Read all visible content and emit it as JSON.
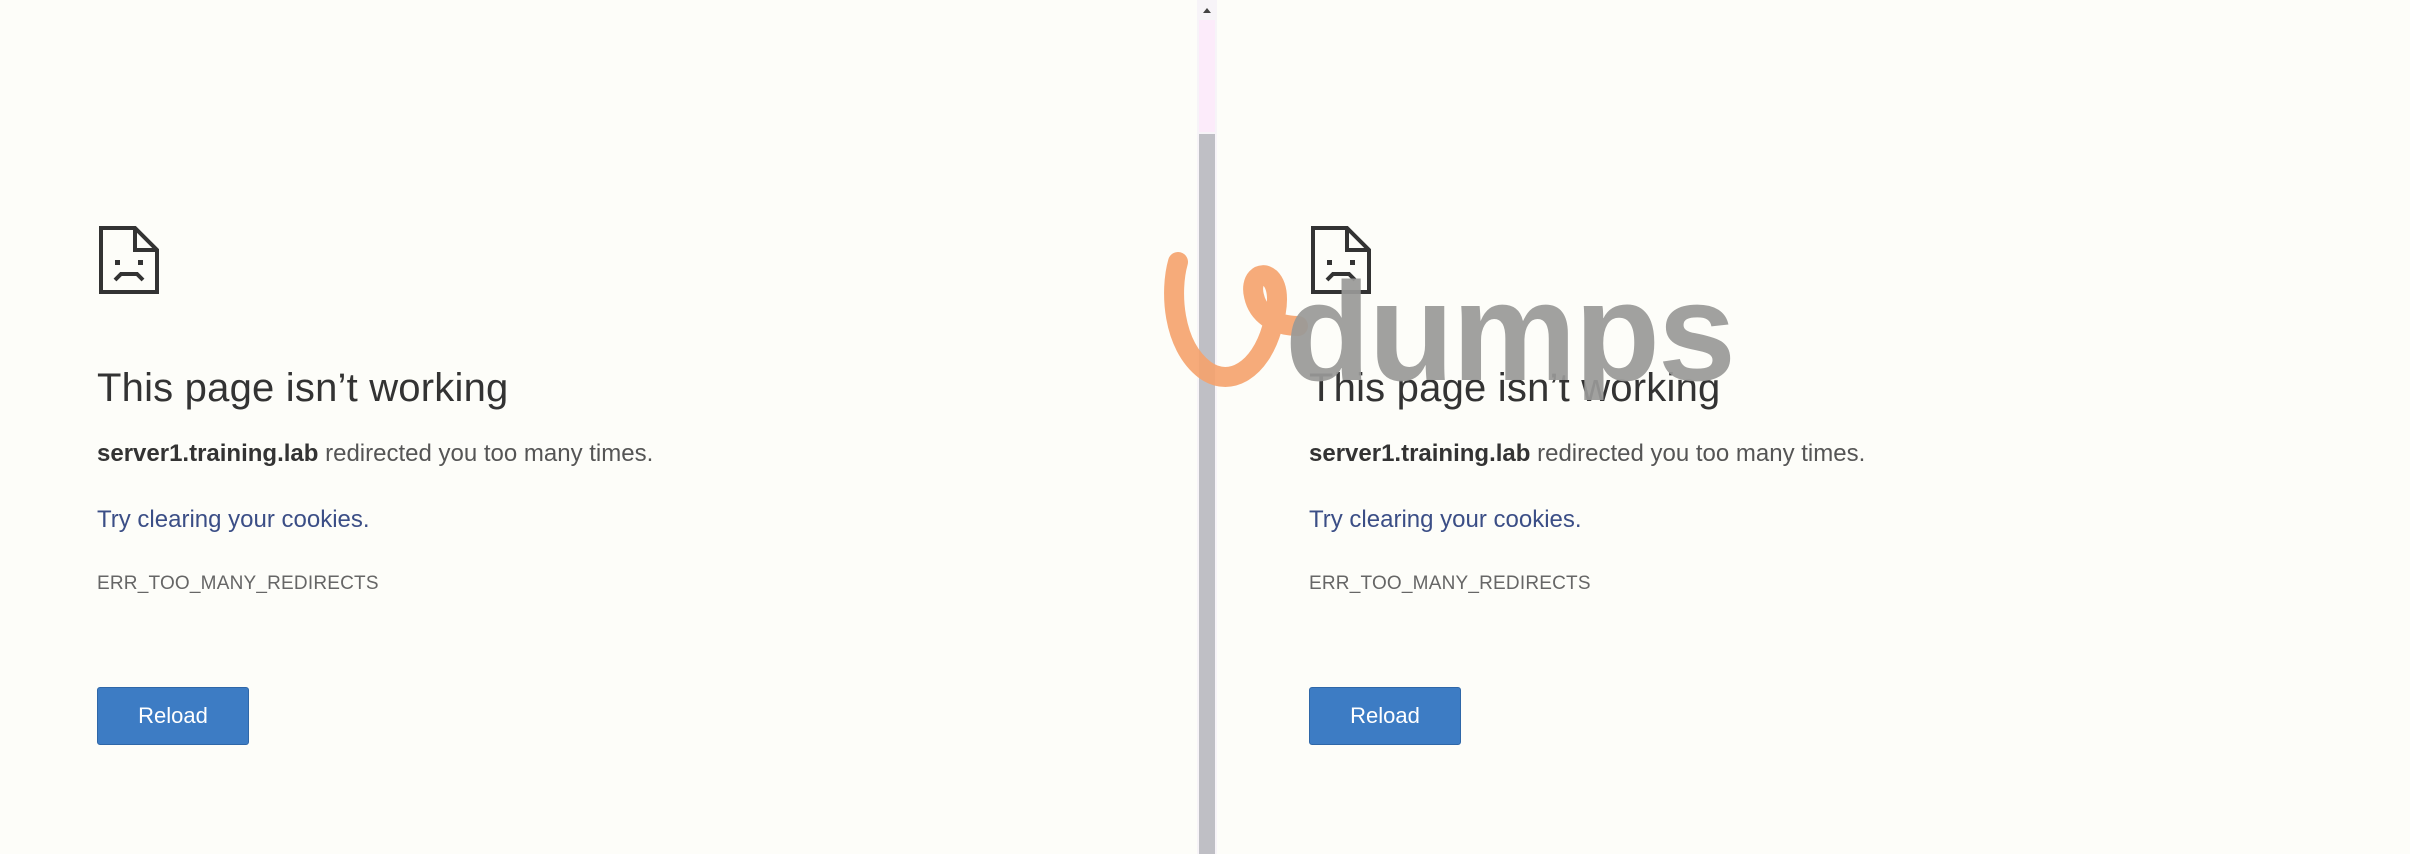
{
  "left_page": {
    "icon": "sad-page-icon",
    "title": "This page isn’t working",
    "host": "server1.training.lab",
    "desc_suffix": " redirected you too many times.",
    "suggestion": "Try clearing your cookies.",
    "error_code": "ERR_TOO_MANY_REDIRECTS",
    "reload_label": "Reload"
  },
  "right_page": {
    "icon": "sad-page-icon",
    "title": "This page isn’t working",
    "host": "server1.training.lab",
    "desc_suffix": " redirected you too many times.",
    "suggestion": "Try clearing your cookies.",
    "error_code": "ERR_TOO_MANY_REDIRECTS",
    "reload_label": "Reload"
  },
  "watermark": {
    "text": "dumps",
    "mark_color": "#f5a26c",
    "text_color": "#9a9a98"
  },
  "colors": {
    "background": "#fdfdf9",
    "button": "#3d7cc4",
    "link": "#3b4e86"
  }
}
